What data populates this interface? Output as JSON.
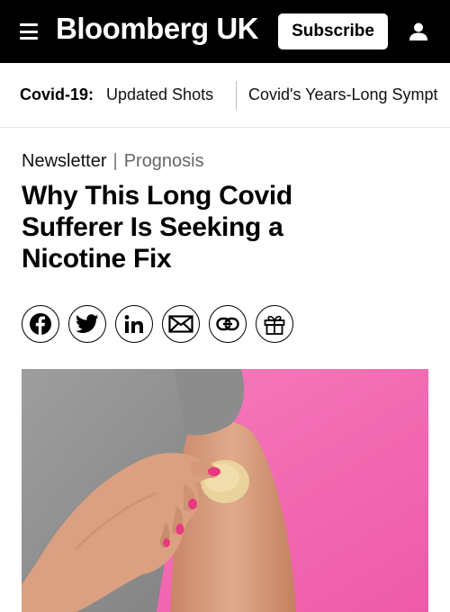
{
  "header": {
    "brand": "Bloomberg UK",
    "subscribe_label": "Subscribe",
    "menu_icon": "hamburger-menu-icon",
    "account_icon": "user-account-icon",
    "background_color": "#000000"
  },
  "topics": {
    "label": "Covid-19:",
    "links": [
      "Updated Shots",
      "Covid's Years-Long Sympt"
    ]
  },
  "article": {
    "kicker_type": "Newsletter",
    "kicker_separator": "|",
    "kicker_section": "Prognosis",
    "headline_lines": [
      "Why This Long Covid",
      "Sufferer Is Seeking a",
      "Nicotine Fix"
    ]
  },
  "share": {
    "icons": [
      "facebook-icon",
      "twitter-icon",
      "linkedin-icon",
      "email-icon",
      "copy-link-icon",
      "gift-article-icon"
    ]
  },
  "hero_image": {
    "description_colors": {
      "background": "#f56fb6",
      "shirt": "#8f8f8f",
      "skin": "#d9a184",
      "patch": "#ecd49a",
      "nail_polish": "#e8387f"
    }
  }
}
